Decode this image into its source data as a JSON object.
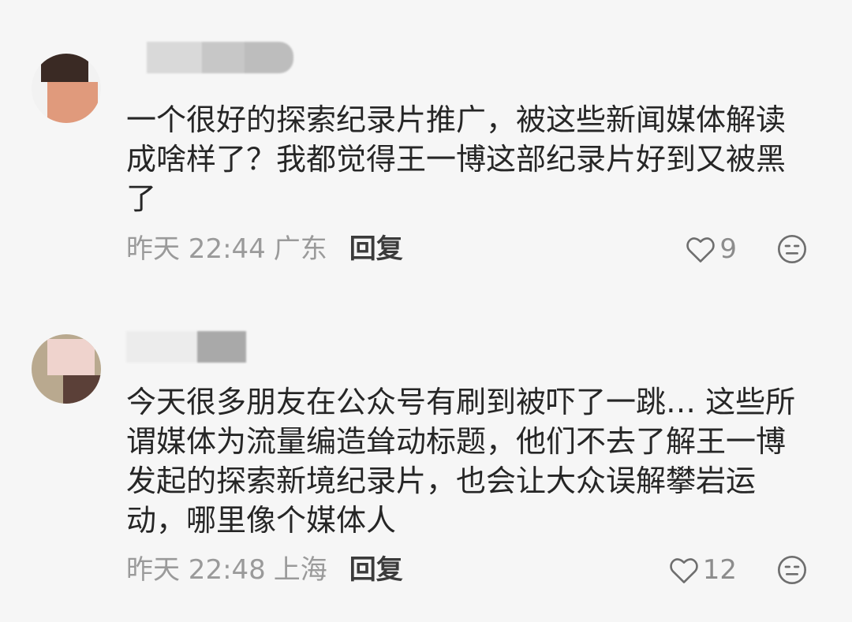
{
  "comments": [
    {
      "text": "一个很好的探索纪录片推广，被这些新闻媒体解读成啥样了？我都觉得王一博这部纪录片好到又被黑了",
      "time": "昨天 22:44",
      "location": "广东",
      "reply_label": "回复",
      "likes": "9"
    },
    {
      "text": "今天很多朋友在公众号有刷到被吓了一跳… 这些所谓媒体为流量编造耸动标题，他们不去了解王一博发起的探索新境纪录片，也会让大众误解攀岩运动，哪里像个媒体人",
      "time": "昨天 22:48",
      "location": "上海",
      "reply_label": "回复",
      "likes": "12"
    }
  ],
  "icons": {
    "like": "heart-outline-icon",
    "react": "neutral-face-icon"
  },
  "colors": {
    "background": "#f6f6f6",
    "text": "#262626",
    "meta": "#9a9a9a",
    "reply": "#3b3b3b",
    "icon": "#6e6e6e"
  }
}
